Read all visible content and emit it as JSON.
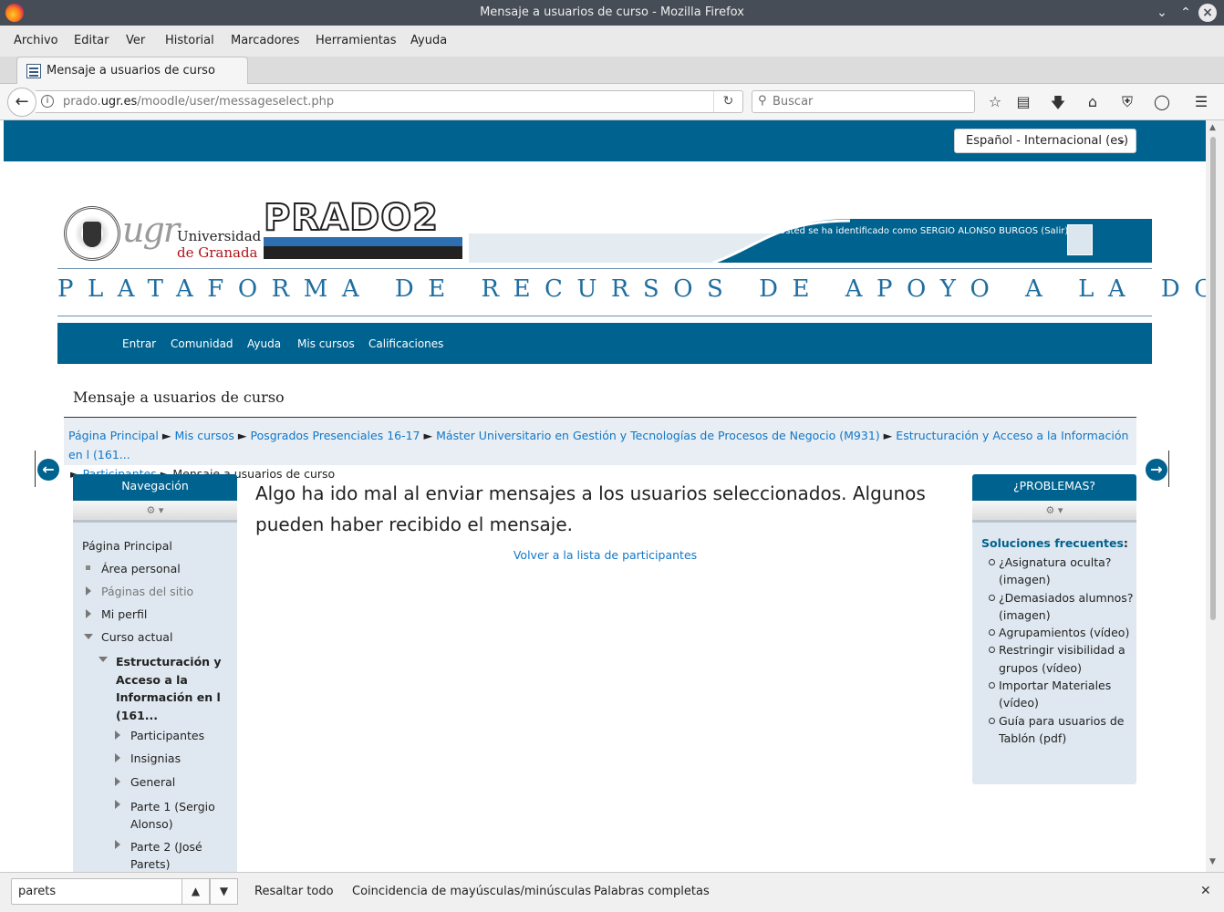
{
  "window": {
    "title": "Mensaje a usuarios de curso - Mozilla Firefox"
  },
  "menu": [
    "Archivo",
    "Editar",
    "Ver",
    "Historial",
    "Marcadores",
    "Herramientas",
    "Ayuda"
  ],
  "tab": {
    "title": "Mensaje a usuarios de curso"
  },
  "address": {
    "host_pre": "prado.",
    "host": "ugr.es",
    "path": "/moodle/user/messageselect.php"
  },
  "search": {
    "placeholder": "Buscar"
  },
  "icons": {
    "back": "back-arrow-icon",
    "info": "info-icon",
    "reload": "reload-icon",
    "search": "search-icon",
    "bookmark": "star-icon",
    "reader": "reading-list-icon",
    "download": "download-icon",
    "home": "home-icon",
    "shield": "shield-icon",
    "pocket": "pocket-icon",
    "menu": "hamburger-icon"
  },
  "site": {
    "language": "Español - Internacional (es)",
    "logo": {
      "ugr": "ugr",
      "univ_line1": "Universidad",
      "univ_line2": "de Granada",
      "prado": "PRADO2"
    },
    "logged_in": "Usted se ha identificado como SERGIO ALONSO BURGOS (Salir)",
    "tagline": "PLATAFORMA DE RECURSOS DE APOYO A LA DOCENCIA",
    "nav": [
      "Entrar",
      "Comunidad",
      "Ayuda",
      "Mis cursos",
      "Calificaciones"
    ],
    "brand_color": "#00628f"
  },
  "page": {
    "heading": "Mensaje a usuarios de curso",
    "breadcrumb": [
      "Página Principal",
      "Mis cursos",
      "Posgrados Presenciales 16-17",
      "Máster Universitario en Gestión y Tecnologías de Procesos de Negocio (M931)",
      "Estructuración y Acceso a la Información en l (161...",
      "Participantes",
      "Mensaje a usuarios de curso"
    ],
    "sep": "►"
  },
  "navigation": {
    "title": "Navegación",
    "controls": "⚙ ▾",
    "items": [
      "Página Principal",
      "Área personal",
      "Páginas del sitio",
      "Mi perfil",
      "Curso actual",
      "Estructuración y Acceso a la Información en l (161...",
      "Participantes",
      "Insignias",
      "General",
      "Parte 1 (Sergio Alonso)",
      "Parte 2 (José Parets)"
    ]
  },
  "main": {
    "error": "Algo ha ido mal al enviar mensajes a los usuarios seleccionados. Algunos pueden haber recibido el mensaje.",
    "back_link": "Volver a la lista de participantes"
  },
  "problems": {
    "title": "¿PROBLEMAS?",
    "controls": "⚙ ▾",
    "subtitle": "Soluciones frecuentes",
    "subtitle_colon": ":",
    "items": [
      "¿Asignatura oculta? (imagen)",
      "¿Demasiados alumnos? (imagen)",
      "Agrupamientos (vídeo)",
      "Restringir visibilidad a grupos (vídeo)",
      "Importar Materiales (vídeo)",
      "Guía para usuarios de Tablón (pdf)"
    ]
  },
  "findbar": {
    "value": "parets",
    "prev": "▲",
    "next": "▼",
    "highlight": "Resaltar todo",
    "match_case": "Coincidencia de mayúsculas/minúsculas",
    "whole_words": "Palabras completas",
    "close": "✕"
  }
}
